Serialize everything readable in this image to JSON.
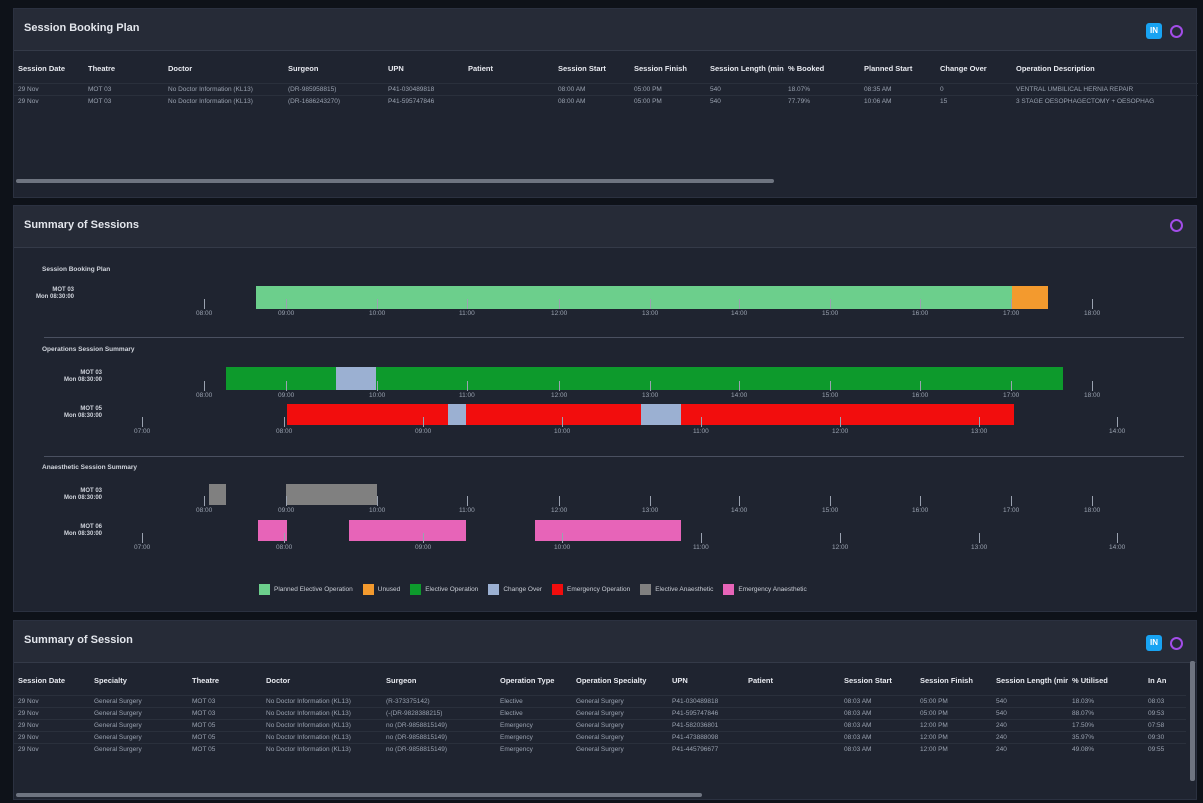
{
  "booking_panel": {
    "title": "Session Booking Plan",
    "columns": [
      "Session Date",
      "Theatre",
      "Doctor",
      "Surgeon",
      "UPN",
      "Patient",
      "Session Start",
      "Session Finish",
      "Session Length (min)",
      "% Booked",
      "Planned Start",
      "Change Over",
      "Operation Description"
    ],
    "rows": [
      [
        "29 Nov",
        "MOT 03",
        "No Doctor Information (KL13)",
        "(DR-985958815)",
        "P41-030489818",
        "",
        "08:00 AM",
        "05:00 PM",
        "540",
        "18.07%",
        "08:35 AM",
        "0",
        "VENTRAL UMBILICAL HERNIA REPAIR"
      ],
      [
        "29 Nov",
        "MOT 03",
        "No Doctor Information (KL13)",
        "(DR-1686243270)",
        "P41-595747846",
        "",
        "08:00 AM",
        "05:00 PM",
        "540",
        "77.79%",
        "10:06 AM",
        "15",
        "3 STAGE OESOPHAGECTOMY + OESOPHAG"
      ]
    ],
    "btn_label": "IN"
  },
  "summary_panel": {
    "title": "Summary of Sessions",
    "booking_section": "Session Booking Plan",
    "operations_section": "Operations Session Summary",
    "anaesthetic_section": "Anaesthetic Session Summary",
    "row_mot03": "MOT 03\nMon 08:30:00",
    "row_mot05": "MOT 05\nMon 08:30:00",
    "row_mot06": "MOT 06\nMon 08:30:00",
    "ticks_a": [
      "08:00",
      "09:00",
      "10:00",
      "11:00",
      "12:00",
      "13:00",
      "14:00",
      "15:00",
      "16:00",
      "17:00",
      "18:00"
    ],
    "ticks_b": [
      "07:00",
      "08:00",
      "09:00",
      "10:00",
      "11:00",
      "12:00",
      "13:00",
      "14:00"
    ],
    "legend": [
      {
        "label": "Planned Elective Operation",
        "color": "#6ccf8c"
      },
      {
        "label": "Unused",
        "color": "#f39a2e"
      },
      {
        "label": "Elective Operation",
        "color": "#0d9a2c"
      },
      {
        "label": "Change Over",
        "color": "#9bb0d2"
      },
      {
        "label": "Emergency Operation",
        "color": "#f20d0d"
      },
      {
        "label": "Elective Anaesthetic",
        "color": "#808080"
      },
      {
        "label": "Emergency Anaesthetic",
        "color": "#e764b8"
      }
    ]
  },
  "session_panel": {
    "title": "Summary of Session",
    "btn_label": "IN",
    "columns": [
      "Session Date",
      "Specialty",
      "Theatre",
      "Doctor",
      "Surgeon",
      "Operation Type",
      "Operation Specialty",
      "UPN",
      "Patient",
      "Session Start",
      "Session Finish",
      "Session Length (min)",
      "% Utilised",
      "In An"
    ],
    "rows": [
      [
        "29 Nov",
        "General Surgery",
        "MOT 03",
        "No Doctor Information (KL13)",
        "(R-373375142)",
        "Elective",
        "General Surgery",
        "P41-030489818",
        "",
        "08:03 AM",
        "05:00 PM",
        "540",
        "18.03%",
        "08:03"
      ],
      [
        "29 Nov",
        "General Surgery",
        "MOT 03",
        "No Doctor Information (KL13)",
        "(-(DR-9828388215)",
        "Elective",
        "General Surgery",
        "P41-595747846",
        "",
        "08:03 AM",
        "05:00 PM",
        "540",
        "88.07%",
        "09:53"
      ],
      [
        "29 Nov",
        "General Surgery",
        "MOT 05",
        "No Doctor Information (KL13)",
        "no (DR-9858815149)",
        "Emergency",
        "General Surgery",
        "P41-582036801",
        "",
        "08:03 AM",
        "12:00 PM",
        "240",
        "17.50%",
        "07:58"
      ],
      [
        "29 Nov",
        "General Surgery",
        "MOT 05",
        "No Doctor Information (KL13)",
        "no (DR-9858815149)",
        "Emergency",
        "General Surgery",
        "P41-473888098",
        "",
        "08:03 AM",
        "12:00 PM",
        "240",
        "35.97%",
        "09:30"
      ],
      [
        "29 Nov",
        "General Surgery",
        "MOT 05",
        "No Doctor Information (KL13)",
        "no (DR-9858815149)",
        "Emergency",
        "General Surgery",
        "P41-445796677",
        "",
        "08:03 AM",
        "12:00 PM",
        "240",
        "49.08%",
        "09:55"
      ]
    ]
  }
}
